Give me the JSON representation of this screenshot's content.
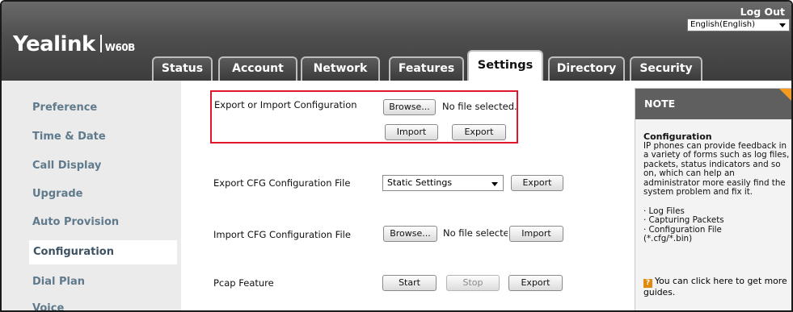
{
  "header": {
    "brand": "Yealink",
    "model": "W60B",
    "logout": "Log Out",
    "language": "English(English)"
  },
  "tabs": [
    {
      "label": "Status"
    },
    {
      "label": "Account"
    },
    {
      "label": "Network"
    },
    {
      "label": "Features"
    },
    {
      "label": "Settings"
    },
    {
      "label": "Directory"
    },
    {
      "label": "Security"
    }
  ],
  "active_tab": "Settings",
  "sidebar": {
    "items": [
      {
        "label": "Preference"
      },
      {
        "label": "Time & Date"
      },
      {
        "label": "Call Display"
      },
      {
        "label": "Upgrade"
      },
      {
        "label": "Auto Provision"
      },
      {
        "label": "Configuration"
      },
      {
        "label": "Dial Plan"
      },
      {
        "label": "Voice"
      }
    ],
    "active": "Configuration"
  },
  "main": {
    "export_import": {
      "label": "Export or Import Configuration",
      "browse": "Browse...",
      "file_status": "No file selected.",
      "import": "Import",
      "export": "Export"
    },
    "export_cfg": {
      "label": "Export CFG Configuration File",
      "select_value": "Static Settings",
      "export": "Export"
    },
    "import_cfg": {
      "label": "Import CFG Configuration File",
      "browse": "Browse...",
      "file_status": "No file selectec",
      "import": "Import"
    },
    "pcap": {
      "label": "Pcap Feature",
      "start": "Start",
      "stop": "Stop",
      "export": "Export"
    }
  },
  "note": {
    "heading": "NOTE",
    "title": "Configuration",
    "body": "IP phones can provide feedback in a variety of forms such as log files, packets, status indicators and so on, which can help an administrator more easily find the system problem and fix it.",
    "list": [
      "· Log Files",
      "· Capturing Packets",
      "· Configuration File",
      "(*.cfg/*.bin)"
    ],
    "help_icon": "?",
    "help_text": "You can click here to get more guides."
  },
  "colors": {
    "highlight_border": "#e0162b",
    "note_corner": "#f39a1f",
    "sidebar_text": "#5f7a8c"
  }
}
